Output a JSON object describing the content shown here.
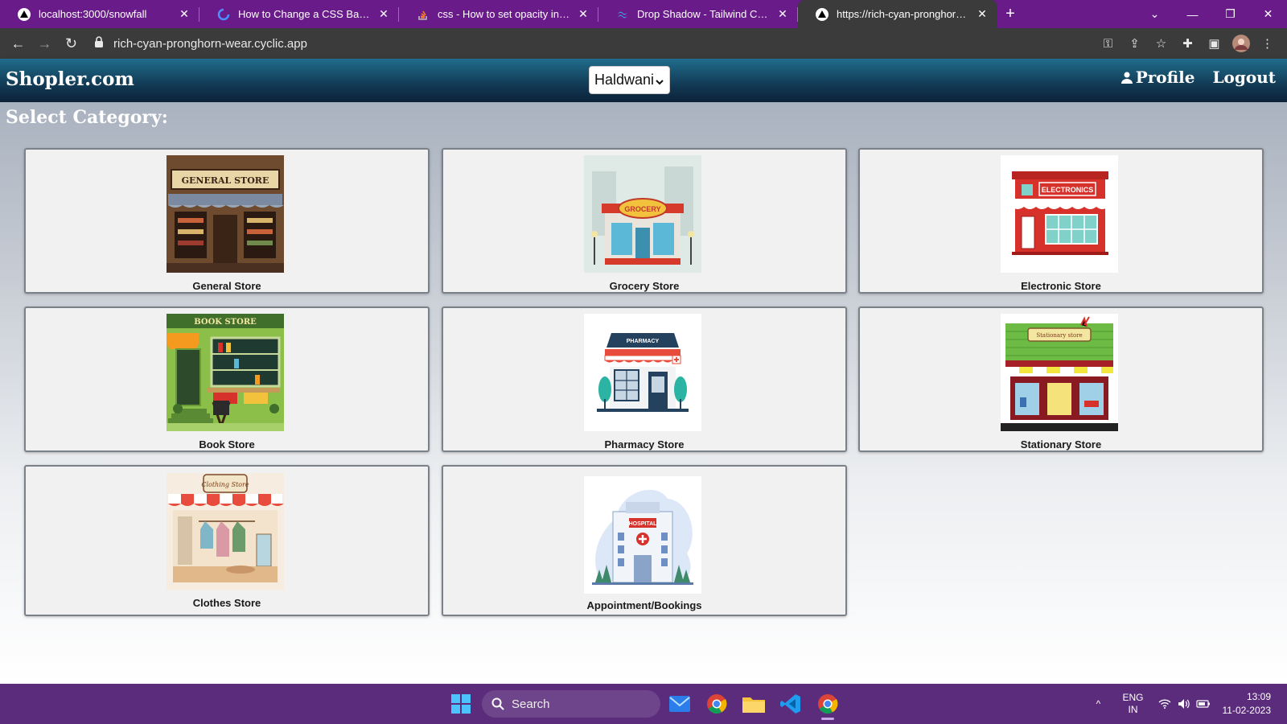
{
  "browser": {
    "tabs": [
      {
        "title": "localhost:3000/snowfall",
        "favicon": "triangle-icon",
        "active": false
      },
      {
        "title": "How to Change a CSS Background",
        "favicon": "spinner-icon",
        "active": false
      },
      {
        "title": "css - How to set opacity in parent",
        "favicon": "stackoverflow-icon",
        "active": false
      },
      {
        "title": "Drop Shadow - Tailwind CSS",
        "favicon": "tailwind-icon",
        "active": false
      },
      {
        "title": "https://rich-cyan-pronghorn-wear",
        "favicon": "triangle-icon",
        "active": true
      }
    ],
    "url": "rich-cyan-pronghorn-wear.cyclic.app",
    "tabstrip_color": "#6a1b8a",
    "toolbar_color": "#3b3b3b"
  },
  "site": {
    "brand": "Shopler.com",
    "city": "Haldwani",
    "nav": {
      "profile": "Profile",
      "logout": "Logout"
    },
    "heading": "Select Category:",
    "nav_color": "#123a55"
  },
  "categories": [
    {
      "label": "General Store",
      "icon": "general-store-image"
    },
    {
      "label": "Grocery Store",
      "icon": "grocery-store-image"
    },
    {
      "label": "Electronic Store",
      "icon": "electronic-store-image"
    },
    {
      "label": "Book Store",
      "icon": "book-store-image"
    },
    {
      "label": "Pharmacy Store",
      "icon": "pharmacy-store-image"
    },
    {
      "label": "Stationary Store",
      "icon": "stationary-store-image"
    },
    {
      "label": "Clothes Store",
      "icon": "clothes-store-image"
    },
    {
      "label": "Appointment/Bookings",
      "icon": "hospital-image"
    }
  ],
  "thumb_text": {
    "general": "GENERAL STORE",
    "grocery": "GROCERY",
    "electronics": "ELECTRONICS",
    "book": "BOOK STORE",
    "pharmacy": "PHARMACY",
    "stationary": "Stationary store",
    "clothes": "Clothing Store",
    "hospital": "HOSPITAL"
  },
  "taskbar": {
    "search": "Search",
    "lang_line1": "ENG",
    "lang_line2": "IN",
    "time": "13:09",
    "date": "11-02-2023",
    "color": "#5a2c7b"
  }
}
